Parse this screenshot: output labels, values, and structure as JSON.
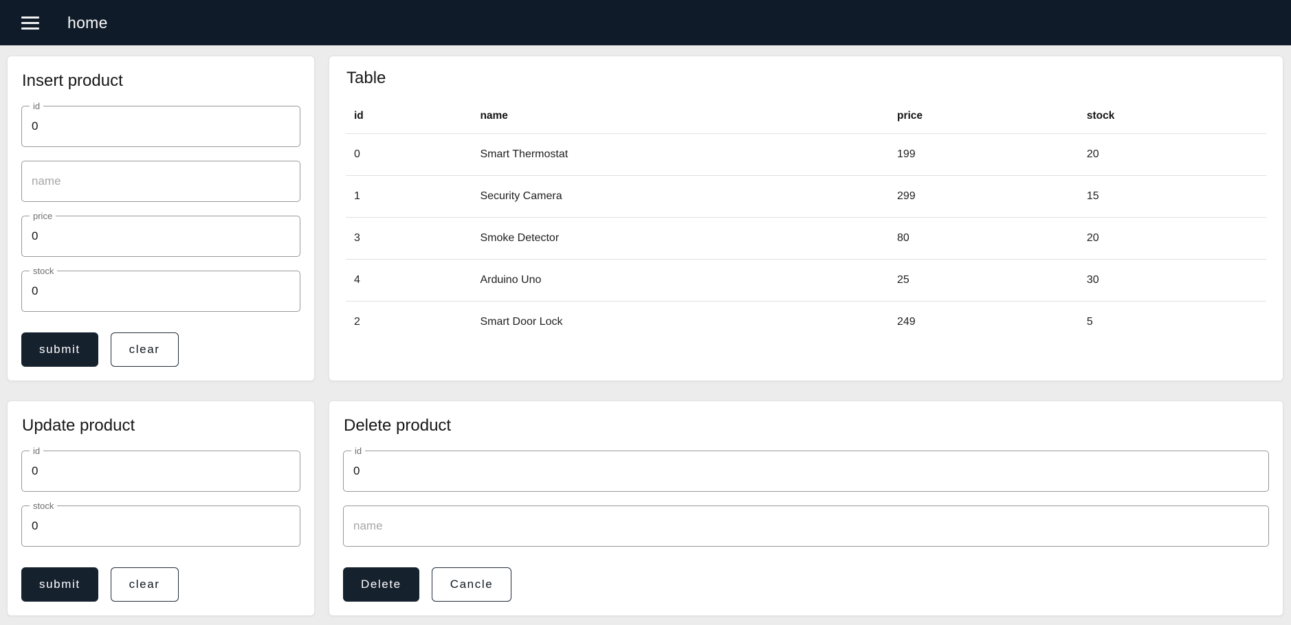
{
  "app_bar": {
    "title": "home",
    "menu_icon": "hamburger-menu-icon"
  },
  "insert_product": {
    "title": "Insert product",
    "fields": {
      "id": {
        "label": "id",
        "value": "0",
        "placeholder": ""
      },
      "name": {
        "label": "",
        "value": "",
        "placeholder": "name"
      },
      "price": {
        "label": "price",
        "value": "0",
        "placeholder": ""
      },
      "stock": {
        "label": "stock",
        "value": "0",
        "placeholder": ""
      }
    },
    "buttons": {
      "submit": "submit",
      "clear": "clear"
    }
  },
  "product_table": {
    "title": "Table",
    "columns": [
      "id",
      "name",
      "price",
      "stock"
    ],
    "rows": [
      [
        "0",
        "Smart Thermostat",
        "199",
        "20"
      ],
      [
        "1",
        "Security Camera",
        "299",
        "15"
      ],
      [
        "3",
        "Smoke Detector",
        "80",
        "20"
      ],
      [
        "4",
        "Arduino Uno",
        "25",
        "30"
      ],
      [
        "2",
        "Smart Door Lock",
        "249",
        "5"
      ]
    ]
  },
  "update_product": {
    "title": "Update product",
    "fields": {
      "id": {
        "label": "id",
        "value": "0"
      },
      "stock": {
        "label": "stock",
        "value": "0"
      }
    },
    "buttons": {
      "submit": "submit",
      "clear": "clear"
    }
  },
  "delete_product": {
    "title": "Delete product",
    "fields": {
      "id": {
        "label": "id",
        "value": "0",
        "placeholder": ""
      },
      "name": {
        "label": "",
        "value": "",
        "placeholder": "name"
      }
    },
    "buttons": {
      "delete": "Delete",
      "cancel": "Cancle"
    }
  },
  "colors": {
    "app_bar_bg": "#101b29",
    "primary_button_bg": "#16212e",
    "page_bg": "#ececec",
    "card_bg": "#ffffff",
    "divider": "#e0e0e0"
  }
}
